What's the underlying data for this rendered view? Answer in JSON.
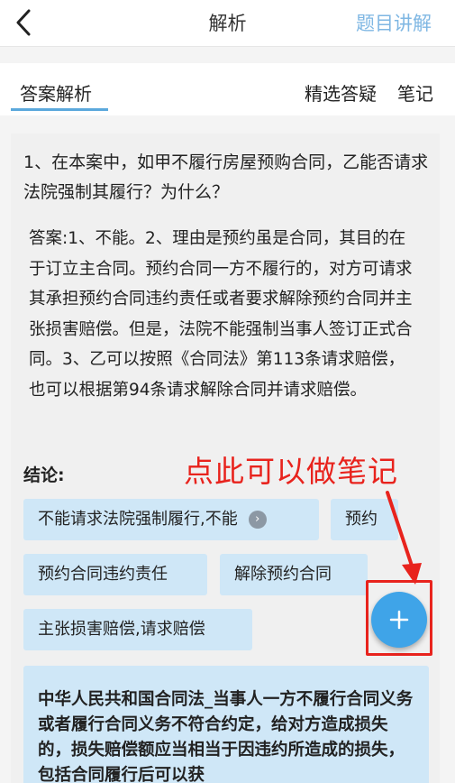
{
  "header": {
    "title": "解析",
    "right_action": "题目讲解"
  },
  "tabs": {
    "answer": "答案解析",
    "questions": "精选答疑",
    "notes": "笔记"
  },
  "question": {
    "text": "1、在本案中，如甲不履行房屋预购合同，乙能否请求法院强制其履行？为什么？"
  },
  "answer": {
    "text": "答案:1、不能。2、理由是预约虽是合同，其目的在于订立主合同。预约合同一方不履行的，对方可请求其承担预约合同违约责任或者要求解除预约合同并主张损害赔偿。但是，法院不能强制当事人签订正式合同。3、乙可以按照《合同法》第113条请求赔偿，也可以根据第94条请求解除合同并请求赔偿。"
  },
  "conclusion": {
    "label": "结论:",
    "chips": [
      "不能请求法院强制履行,不能",
      "预约",
      "预约合同违约责任",
      "解除预约合同",
      "主张损害赔偿,请求赔偿"
    ]
  },
  "annotation": {
    "text": "点此可以做笔记",
    "color": "#e8231d"
  },
  "law": {
    "text": "中华人民共和国合同法_当事人一方不履行合同义务或者履行合同义务不符合约定，给对方造成损失的，损失赔偿额应当相当于因违约所造成的损失，包括合同履行后可以获"
  },
  "icons": {
    "back": "chevron-left-icon",
    "chip_more": "chevron-right-circle-icon",
    "add_note": "plus-icon"
  },
  "colors": {
    "accent": "#3fa4e8",
    "chip_bg": "#cfe7f7",
    "tab_underline": "#5ba8dc"
  }
}
